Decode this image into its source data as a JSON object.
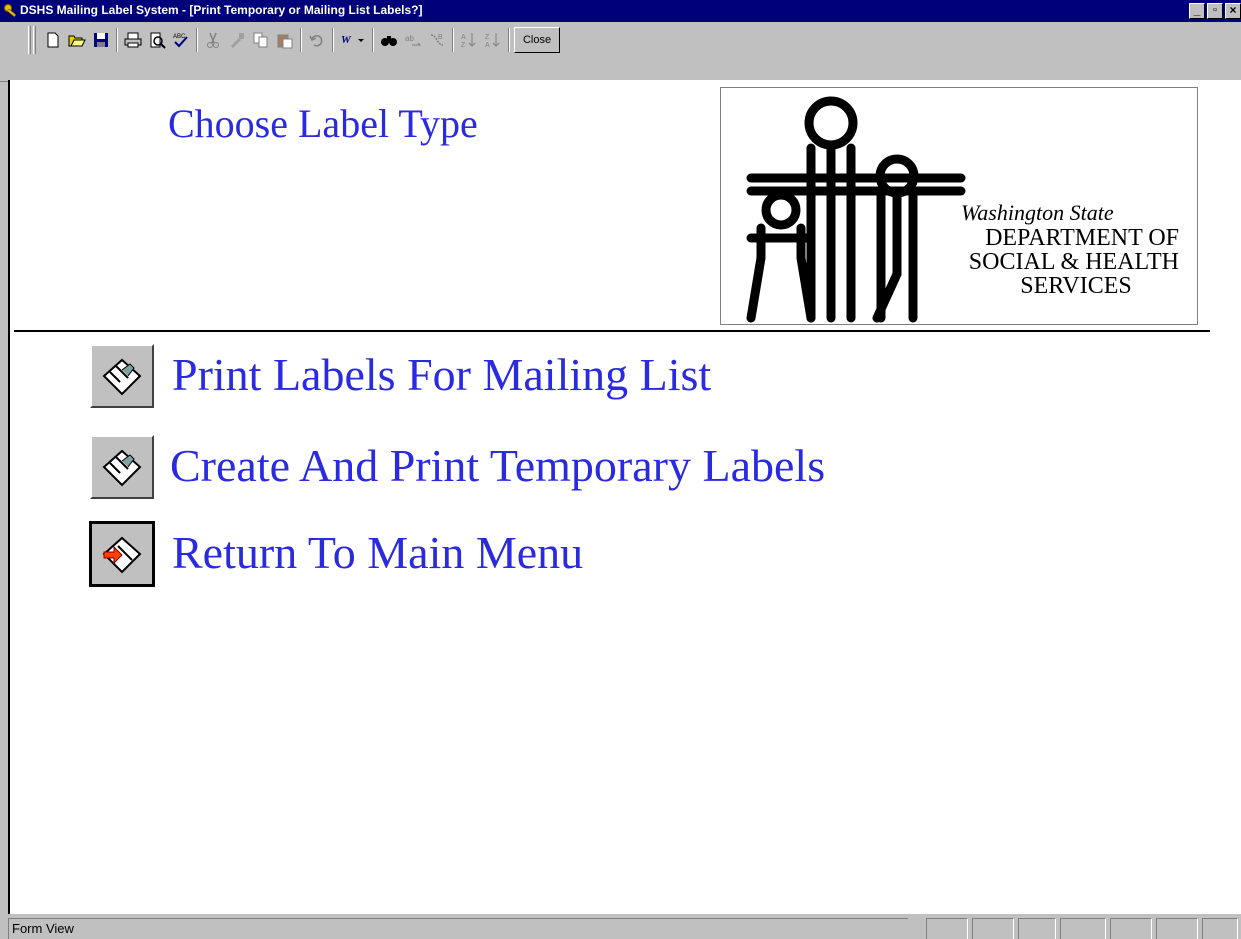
{
  "window": {
    "title": "DSHS Mailing Label System - [Print Temporary or Mailing List Labels?]",
    "min_symbol": "_",
    "max_symbol": "▫",
    "close_symbol": "×"
  },
  "toolbar": {
    "buttons": [
      "new-icon",
      "open-icon",
      "save-icon",
      "print-icon",
      "print-preview-icon",
      "spelling-icon",
      "cut-icon",
      "format-painter-icon",
      "copy-icon",
      "paste-icon",
      "undo-icon",
      "office-links-icon",
      "find-icon",
      "replace-icon",
      "goto-icon",
      "sort-ascending-icon",
      "sort-descending-icon"
    ],
    "close_label": "Close"
  },
  "form": {
    "heading": "Choose Label Type",
    "logo": {
      "line1": "Washington State",
      "line2": "DEPARTMENT OF",
      "line3": "SOCIAL & HEALTH",
      "line4": "SERVICES"
    },
    "menu": [
      {
        "label": "Print Labels For Mailing List",
        "icon": "open-book-icon"
      },
      {
        "label": "Create And Print Temporary Labels",
        "icon": "open-book-icon"
      },
      {
        "label": "Return To Main Menu",
        "icon": "exit-door-icon"
      }
    ]
  },
  "status": {
    "text": "Form View"
  },
  "colors": {
    "title_bar": "#00007b",
    "accent_text": "#2a2ae0",
    "face": "#c0c0c0"
  }
}
